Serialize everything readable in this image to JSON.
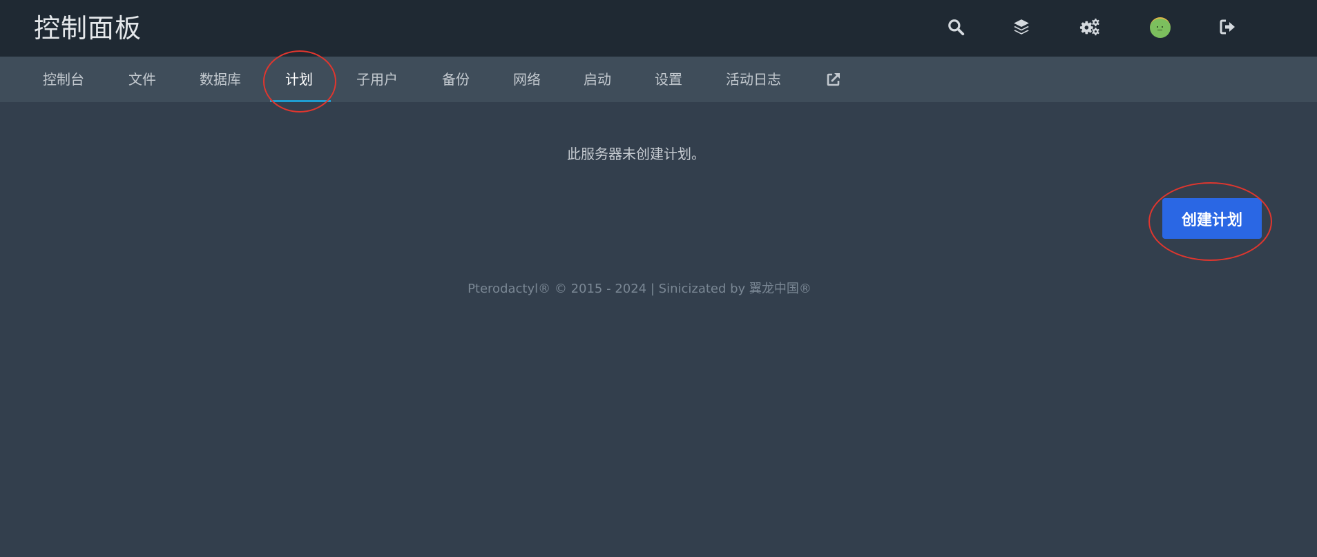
{
  "header": {
    "title": "控制面板",
    "icons": [
      "search-icon",
      "layers-icon",
      "cogs-icon",
      "avatar",
      "logout-icon"
    ]
  },
  "nav": {
    "tabs": [
      {
        "label": "控制台"
      },
      {
        "label": "文件"
      },
      {
        "label": "数据库"
      },
      {
        "label": "计划",
        "active": true
      },
      {
        "label": "子用户"
      },
      {
        "label": "备份"
      },
      {
        "label": "网络"
      },
      {
        "label": "启动"
      },
      {
        "label": "设置"
      },
      {
        "label": "活动日志"
      }
    ],
    "external_link_icon": "external-link-icon"
  },
  "main": {
    "empty_message": "此服务器未创建计划。",
    "create_button_label": "创建计划"
  },
  "footer": {
    "text": "Pterodactyl® © 2015 - 2024 | Sinicizated by 翼龙中国®"
  },
  "colors": {
    "topbar": "#1f2933",
    "subnav": "#3f4d5a",
    "page": "#333f4d",
    "accent_underline": "#1f9ed1",
    "primary_button": "#2a67e4",
    "annotation": "#e0362e"
  }
}
